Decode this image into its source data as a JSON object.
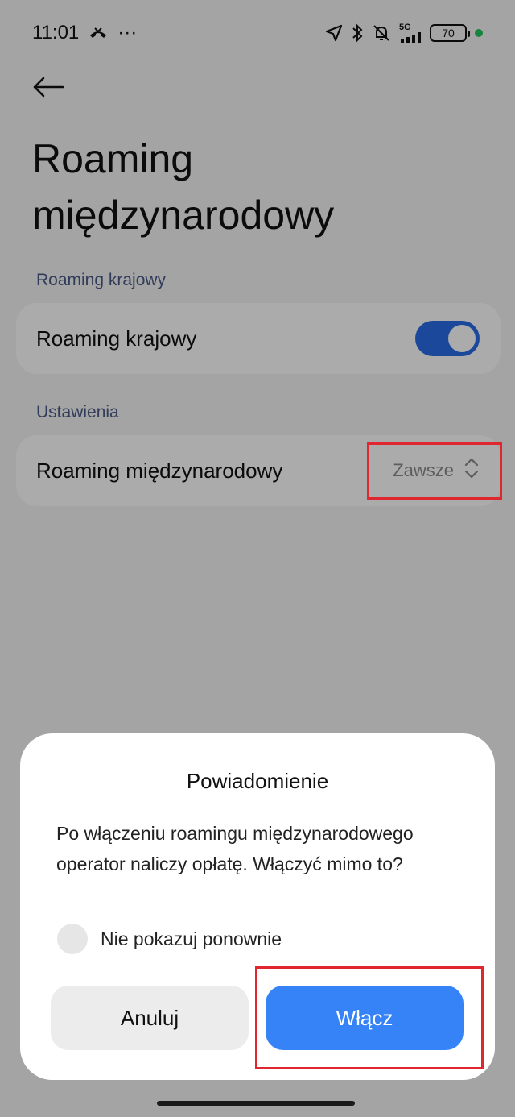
{
  "status_bar": {
    "time": "11:01",
    "more": "···",
    "network": "5G",
    "battery": "70",
    "icons": [
      "missed-call-icon",
      "location-icon",
      "bluetooth-icon",
      "bell-muted-icon",
      "signal-icon"
    ],
    "dot_color": "#22c55e"
  },
  "header": {
    "title": "Roaming międzynarodowy"
  },
  "sections": {
    "domestic": {
      "label": "Roaming krajowy",
      "item_label": "Roaming krajowy",
      "toggle_on": true
    },
    "settings": {
      "label": "Ustawienia",
      "item_label": "Roaming międzynarodowy",
      "value": "Zawsze"
    }
  },
  "dialog": {
    "title": "Powiadomienie",
    "message": "Po włączeniu roamingu międzynarodowego operator naliczy opłatę. Włączyć mimo to?",
    "checkbox_label": "Nie pokazuj ponownie",
    "cancel_label": "Anuluj",
    "ok_label": "Włącz"
  },
  "colors": {
    "accent": "#3583f6",
    "toggle": "#2b6ce8",
    "highlight": "#e0262e"
  }
}
